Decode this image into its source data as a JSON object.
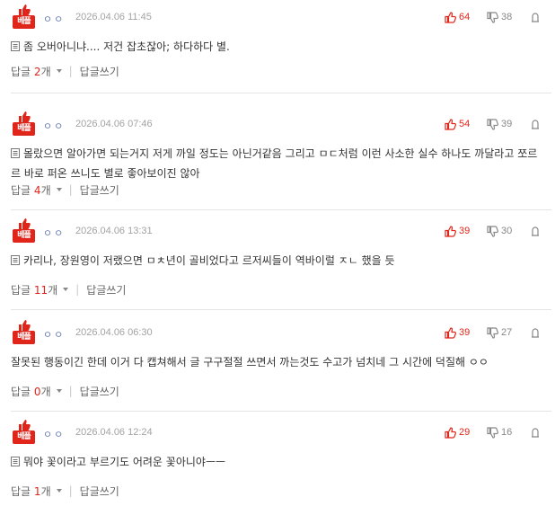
{
  "badge_label": "베플",
  "reply_label": "답글",
  "count_suffix": "개",
  "write_reply_label": "답글쓰기",
  "separator": "|",
  "accent_color": "#e0261b",
  "comments": [
    {
      "nickname": "ㅇㅇ",
      "date": "2026.04.06 11:45",
      "likes": "64",
      "dislikes": "38",
      "text": "좀 오버아니냐.... 저건 잡초잖아; 하다하다 별.",
      "has_doc_icon": true,
      "reply_count": "2"
    },
    {
      "nickname": "ㅇㅇ",
      "date": "2026.04.06 07:46",
      "likes": "54",
      "dislikes": "39",
      "text": "몰랐으면 알아가면 되는거지 저게 까일 정도는 아닌거같음 그리고 ㅁㄷ처럼 이런 사소한 실수 하나도 까달라고 쪼르르 바로 퍼온 쓰니도 별로 좋아보이진 않아",
      "has_doc_icon": true,
      "reply_count": "4"
    },
    {
      "nickname": "ㅇㅇ",
      "date": "2026.04.06 13:31",
      "likes": "39",
      "dislikes": "30",
      "text": "카리나, 장원영이 저랬으면 ㅁㅊ년이 골비었다고 르저씨들이 역바이럴 ㅈㄴ 했을 듯",
      "has_doc_icon": true,
      "reply_count": "11"
    },
    {
      "nickname": "ㅇㅇ",
      "date": "2026.04.06 06:30",
      "likes": "39",
      "dislikes": "27",
      "text": "잘못된 행동이긴 한데 이거 다 캡쳐해서 글 구구절절 쓰면서 까는것도 수고가 넘치네 그 시간에 덕질해 ㅇㅇ",
      "has_doc_icon": false,
      "reply_count": "0"
    },
    {
      "nickname": "ㅇㅇ",
      "date": "2026.04.06 12:24",
      "likes": "29",
      "dislikes": "16",
      "text": "뭐야 꽃이라고 부르기도 어려운 꽃아니야ㅡㅡ",
      "has_doc_icon": true,
      "reply_count": "1"
    }
  ]
}
